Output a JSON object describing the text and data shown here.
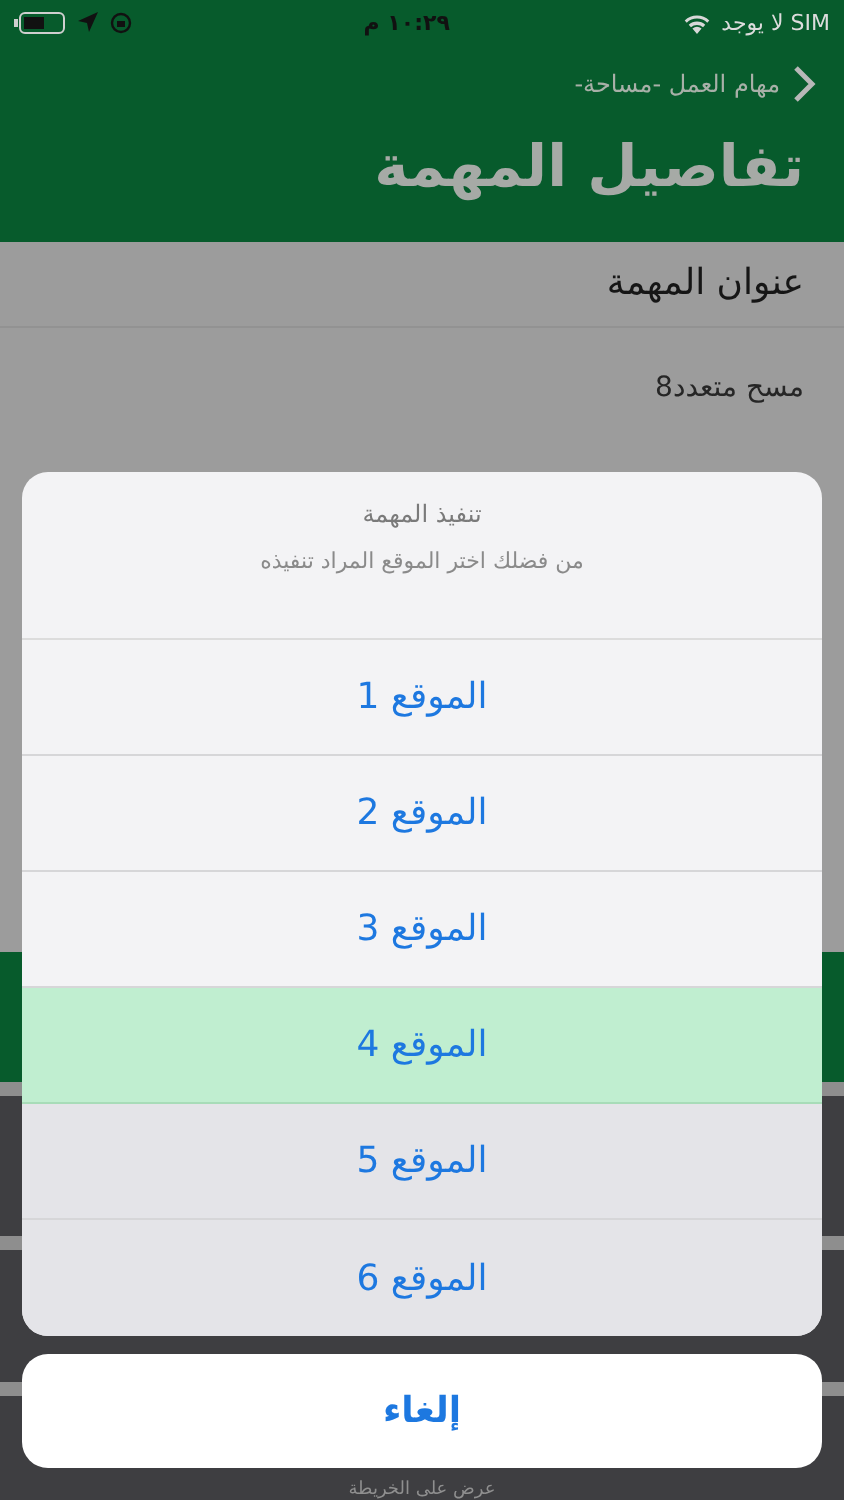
{
  "status_bar": {
    "carrier": "لا يوجد SIM",
    "time": "١٠:٢٩ م"
  },
  "nav": {
    "back_label": "مهام العمل -مساحة-",
    "title": "تفاصيل المهمة"
  },
  "fields": [
    {
      "label": "عنوان المهمة",
      "value": "مسح متعدد8"
    }
  ],
  "footer_link": "عرض على الخريطة",
  "action_sheet": {
    "title": "تنفيذ المهمة",
    "message": "من فضلك اختر الموقع المراد تنفيذه",
    "actions": [
      {
        "label": "الموقع 1",
        "selected": false
      },
      {
        "label": "الموقع 2",
        "selected": false
      },
      {
        "label": "الموقع 3",
        "selected": false
      },
      {
        "label": "الموقع 4",
        "selected": true
      },
      {
        "label": "الموقع 5",
        "selected": false
      },
      {
        "label": "الموقع 6",
        "selected": false
      }
    ],
    "cancel": "إلغاء"
  }
}
